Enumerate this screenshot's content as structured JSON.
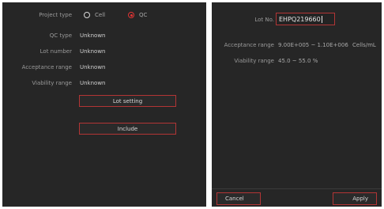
{
  "left": {
    "project_type_label": "Project type",
    "options": [
      {
        "label": "Cell",
        "selected": false
      },
      {
        "label": "QC",
        "selected": true
      }
    ],
    "rows": [
      {
        "label": "QC type",
        "value": "Unknown"
      },
      {
        "label": "Lot number",
        "value": "Unknown"
      },
      {
        "label": "Acceptance range",
        "value": "Unknown"
      },
      {
        "label": "Viability range",
        "value": "Unknown"
      }
    ],
    "lot_setting_label": "Lot setting",
    "include_label": "Include"
  },
  "right": {
    "lot_no_label": "Lot No.",
    "lot_no_value": "EHPQ219660",
    "acceptance_label": "Acceptance range",
    "acceptance_value": "9.00E+005 ~ 1.10E+006",
    "acceptance_unit": "Cells/mL",
    "viability_label": "Viability range",
    "viability_value": "45.0 ~ 55.0 %",
    "cancel_label": "Cancel",
    "apply_label": "Apply"
  },
  "colors": {
    "accent": "#e03434",
    "panel": "#262626",
    "border": "#b23535"
  }
}
